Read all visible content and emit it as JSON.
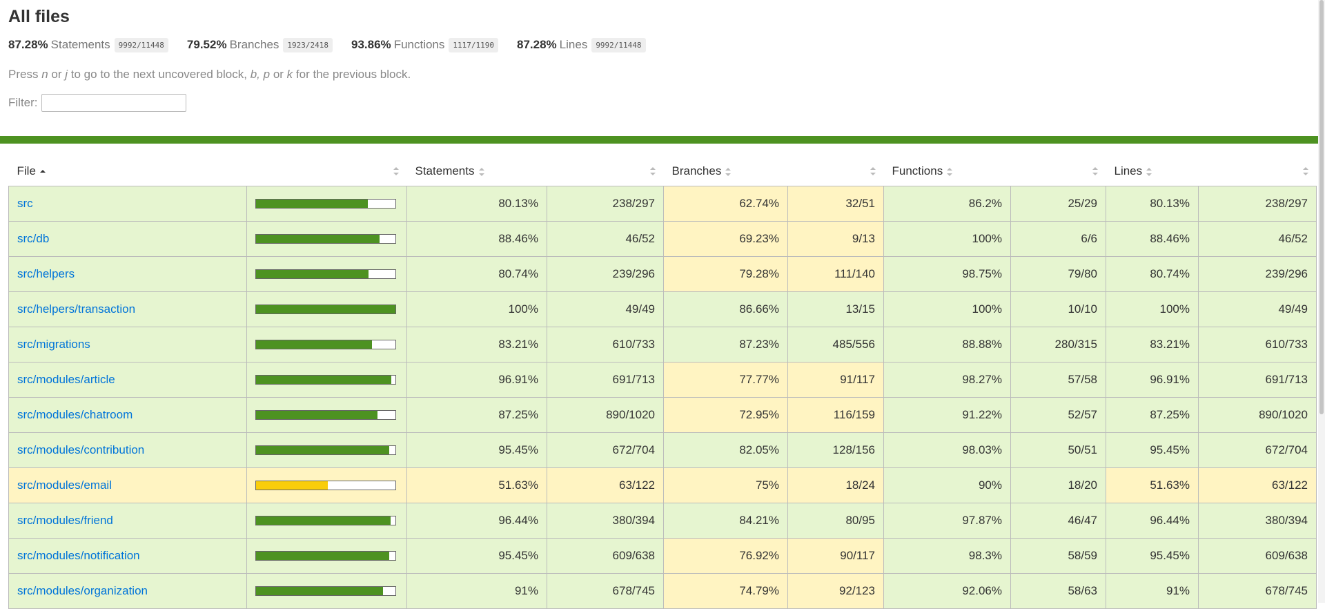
{
  "title": "All files",
  "summary": [
    {
      "pct": "87.28%",
      "label": "Statements",
      "frac": "9992/11448"
    },
    {
      "pct": "79.52%",
      "label": "Branches",
      "frac": "1923/2418"
    },
    {
      "pct": "93.86%",
      "label": "Functions",
      "frac": "1117/1190"
    },
    {
      "pct": "87.28%",
      "label": "Lines",
      "frac": "9992/11448"
    }
  ],
  "help": {
    "press": "Press",
    "n": "n",
    "or1": "or",
    "j": "j",
    "next": "to go to the next uncovered block,",
    "b": "b,",
    "p": "p",
    "or2": "or",
    "k": "k",
    "prev": "for the previous block."
  },
  "filter": {
    "label": "Filter:",
    "value": ""
  },
  "colors": {
    "high_bg": "#e6f5d0",
    "medium_bg": "#fff4c2",
    "high_bar": "#4d9221",
    "medium_bar": "#f9cd0b",
    "link": "#0074d9"
  },
  "headers": {
    "file": "File",
    "statements": "Statements",
    "branches": "Branches",
    "functions": "Functions",
    "lines": "Lines"
  },
  "rows": [
    {
      "file": "src",
      "pct": 80.13,
      "s_pct": "80.13%",
      "s_frac": "238/297",
      "b_pct": "62.74%",
      "b_frac": "32/51",
      "f_pct": "86.2%",
      "f_frac": "25/29",
      "l_pct": "80.13%",
      "l_frac": "238/297",
      "s_lvl": "high",
      "b_lvl": "medium",
      "f_lvl": "high",
      "l_lvl": "high"
    },
    {
      "file": "src/db",
      "pct": 88.46,
      "s_pct": "88.46%",
      "s_frac": "46/52",
      "b_pct": "69.23%",
      "b_frac": "9/13",
      "f_pct": "100%",
      "f_frac": "6/6",
      "l_pct": "88.46%",
      "l_frac": "46/52",
      "s_lvl": "high",
      "b_lvl": "medium",
      "f_lvl": "high",
      "l_lvl": "high"
    },
    {
      "file": "src/helpers",
      "pct": 80.74,
      "s_pct": "80.74%",
      "s_frac": "239/296",
      "b_pct": "79.28%",
      "b_frac": "111/140",
      "f_pct": "98.75%",
      "f_frac": "79/80",
      "l_pct": "80.74%",
      "l_frac": "239/296",
      "s_lvl": "high",
      "b_lvl": "medium",
      "f_lvl": "high",
      "l_lvl": "high"
    },
    {
      "file": "src/helpers/transaction",
      "pct": 100,
      "s_pct": "100%",
      "s_frac": "49/49",
      "b_pct": "86.66%",
      "b_frac": "13/15",
      "f_pct": "100%",
      "f_frac": "10/10",
      "l_pct": "100%",
      "l_frac": "49/49",
      "s_lvl": "high",
      "b_lvl": "high",
      "f_lvl": "high",
      "l_lvl": "high"
    },
    {
      "file": "src/migrations",
      "pct": 83.21,
      "s_pct": "83.21%",
      "s_frac": "610/733",
      "b_pct": "87.23%",
      "b_frac": "485/556",
      "f_pct": "88.88%",
      "f_frac": "280/315",
      "l_pct": "83.21%",
      "l_frac": "610/733",
      "s_lvl": "high",
      "b_lvl": "high",
      "f_lvl": "high",
      "l_lvl": "high"
    },
    {
      "file": "src/modules/article",
      "pct": 96.91,
      "s_pct": "96.91%",
      "s_frac": "691/713",
      "b_pct": "77.77%",
      "b_frac": "91/117",
      "f_pct": "98.27%",
      "f_frac": "57/58",
      "l_pct": "96.91%",
      "l_frac": "691/713",
      "s_lvl": "high",
      "b_lvl": "medium",
      "f_lvl": "high",
      "l_lvl": "high"
    },
    {
      "file": "src/modules/chatroom",
      "pct": 87.25,
      "s_pct": "87.25%",
      "s_frac": "890/1020",
      "b_pct": "72.95%",
      "b_frac": "116/159",
      "f_pct": "91.22%",
      "f_frac": "52/57",
      "l_pct": "87.25%",
      "l_frac": "890/1020",
      "s_lvl": "high",
      "b_lvl": "medium",
      "f_lvl": "high",
      "l_lvl": "high"
    },
    {
      "file": "src/modules/contribution",
      "pct": 95.45,
      "s_pct": "95.45%",
      "s_frac": "672/704",
      "b_pct": "82.05%",
      "b_frac": "128/156",
      "f_pct": "98.03%",
      "f_frac": "50/51",
      "l_pct": "95.45%",
      "l_frac": "672/704",
      "s_lvl": "high",
      "b_lvl": "high",
      "f_lvl": "high",
      "l_lvl": "high"
    },
    {
      "file": "src/modules/email",
      "pct": 51.63,
      "s_pct": "51.63%",
      "s_frac": "63/122",
      "b_pct": "75%",
      "b_frac": "18/24",
      "f_pct": "90%",
      "f_frac": "18/20",
      "l_pct": "51.63%",
      "l_frac": "63/122",
      "s_lvl": "medium",
      "b_lvl": "medium",
      "f_lvl": "high",
      "l_lvl": "medium"
    },
    {
      "file": "src/modules/friend",
      "pct": 96.44,
      "s_pct": "96.44%",
      "s_frac": "380/394",
      "b_pct": "84.21%",
      "b_frac": "80/95",
      "f_pct": "97.87%",
      "f_frac": "46/47",
      "l_pct": "96.44%",
      "l_frac": "380/394",
      "s_lvl": "high",
      "b_lvl": "high",
      "f_lvl": "high",
      "l_lvl": "high"
    },
    {
      "file": "src/modules/notification",
      "pct": 95.45,
      "s_pct": "95.45%",
      "s_frac": "609/638",
      "b_pct": "76.92%",
      "b_frac": "90/117",
      "f_pct": "98.3%",
      "f_frac": "58/59",
      "l_pct": "95.45%",
      "l_frac": "609/638",
      "s_lvl": "high",
      "b_lvl": "medium",
      "f_lvl": "high",
      "l_lvl": "high"
    },
    {
      "file": "src/modules/organization",
      "pct": 91,
      "s_pct": "91%",
      "s_frac": "678/745",
      "b_pct": "74.79%",
      "b_frac": "92/123",
      "f_pct": "92.06%",
      "f_frac": "58/63",
      "l_pct": "91%",
      "l_frac": "678/745",
      "s_lvl": "high",
      "b_lvl": "medium",
      "f_lvl": "high",
      "l_lvl": "high"
    }
  ]
}
